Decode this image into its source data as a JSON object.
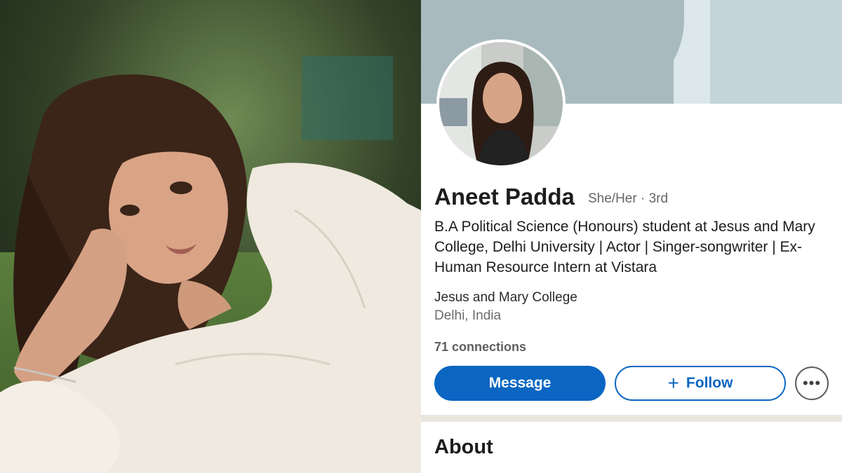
{
  "profile": {
    "name": "Aneet Padda",
    "pronouns_degree": "She/Her · 3rd",
    "headline": "B.A Political Science (Honours) student at Jesus and Mary College, Delhi University | Actor | Singer-songwriter | Ex-Human Resource Intern at Vistara",
    "school": "Jesus and Mary College",
    "location": "Delhi, India",
    "connections": "71 connections"
  },
  "actions": {
    "message_label": "Message",
    "follow_label": "Follow",
    "more_icon": "more-horizontal-icon",
    "follow_icon": "plus-icon"
  },
  "sections": {
    "about_heading": "About"
  },
  "colors": {
    "brand_blue": "#0a66c2",
    "banner": "#a9babf"
  }
}
